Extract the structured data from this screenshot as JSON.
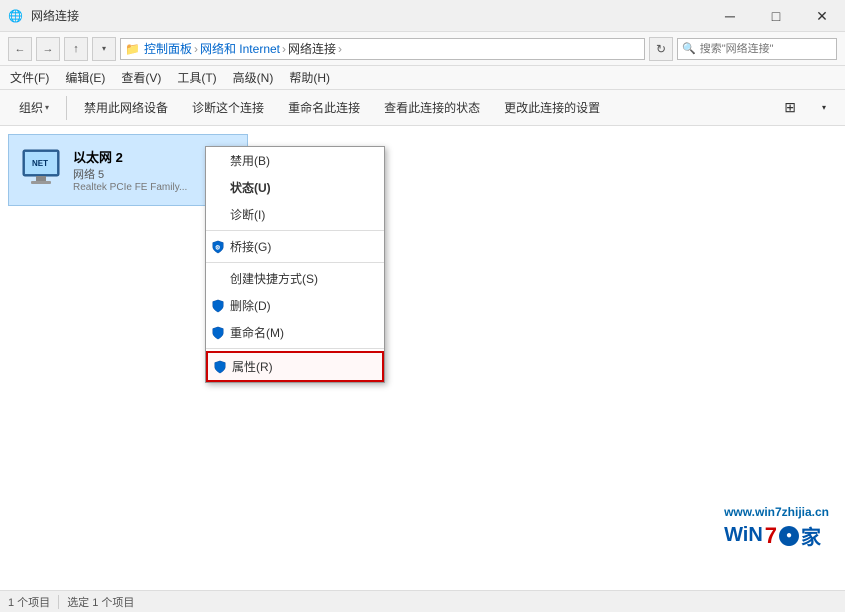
{
  "window": {
    "title": "网络连接",
    "min_btn": "─",
    "max_btn": "□",
    "close_btn": "✕"
  },
  "nav": {
    "back": "←",
    "forward": "→",
    "up": "↑",
    "breadcrumb": [
      {
        "label": "控制面板",
        "sep": " ›"
      },
      {
        "label": "网络和 Internet",
        "sep": " ›"
      },
      {
        "label": "网络连接",
        "sep": " ›"
      }
    ],
    "search_placeholder": "搜索\"网络连接\""
  },
  "menubar": {
    "items": [
      "文件(F)",
      "编辑(E)",
      "查看(V)",
      "工具(T)",
      "高级(N)",
      "帮助(H)"
    ]
  },
  "toolbar": {
    "organize": "组织",
    "organize_arrow": "▾",
    "buttons": [
      "禁用此网络设备",
      "诊断这个连接",
      "重命名此连接",
      "查看此连接的状态",
      "更改此连接的设置"
    ],
    "view_icon": "⊞",
    "more_arrow": "▾"
  },
  "adapter": {
    "name": "以太网 2",
    "network": "网络 5",
    "driver": "Realtek PCIe FE Family..."
  },
  "context_menu": {
    "items": [
      {
        "label": "禁用(B)",
        "has_shield": false,
        "separator_after": false
      },
      {
        "label": "状态(U)",
        "has_shield": false,
        "separator_after": true,
        "bold": true
      },
      {
        "label": "诊断(I)",
        "has_shield": false,
        "separator_after": true
      },
      {
        "label": "桥接(G)",
        "has_shield": true,
        "separator_after": false
      },
      {
        "label": "创建快捷方式(S)",
        "has_shield": false,
        "separator_after": false
      },
      {
        "label": "删除(D)",
        "has_shield": true,
        "separator_after": false
      },
      {
        "label": "重命名(M)",
        "has_shield": false,
        "separator_after": true
      },
      {
        "label": "属性(R)",
        "has_shield": true,
        "separator_after": false,
        "highlighted": true
      }
    ]
  },
  "statusbar": {
    "total": "1 个项目",
    "selected": "选定 1 个项目"
  },
  "watermark": {
    "url": "www.win7zhijia.cn",
    "win": "WiN",
    "num": "7",
    "dot": "●",
    "jia": "家"
  }
}
